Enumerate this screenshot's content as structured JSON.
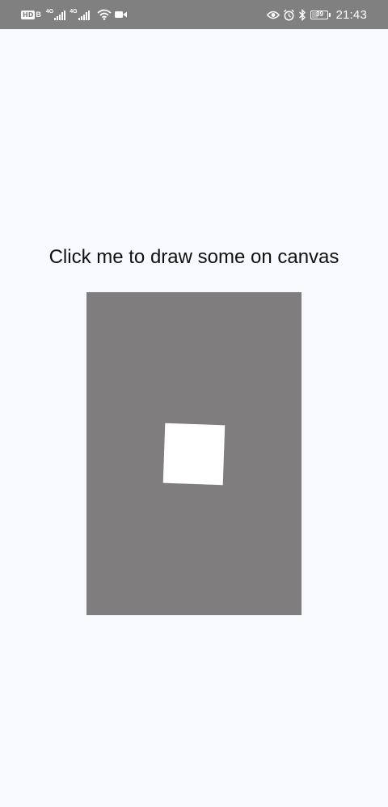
{
  "status_bar": {
    "hd_label": "HD",
    "hd_sub": "B",
    "signal_1_net": "4G",
    "signal_2_net": "4G",
    "battery_level": "39",
    "time": "21:43",
    "left_icons": [
      "hd-icon",
      "signal-icon",
      "signal-icon",
      "wifi-icon",
      "video-icon"
    ],
    "right_icons": [
      "eye-icon",
      "alarm-icon",
      "bluetooth-icon",
      "battery-icon"
    ]
  },
  "main": {
    "prompt_text": "Click me to draw some on canvas"
  },
  "canvas": {
    "background": "#807d7e",
    "shape_color": "#ffffff"
  }
}
